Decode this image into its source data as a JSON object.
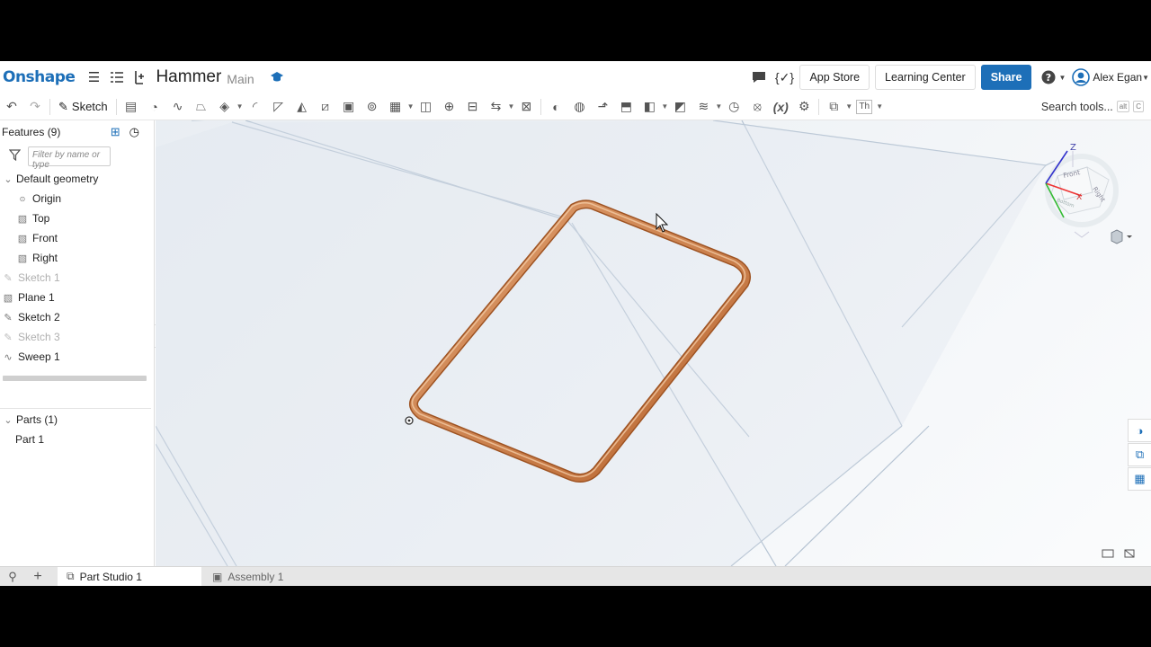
{
  "app": {
    "logo": "Onshape",
    "doc_title": "Hammer",
    "branch": "Main",
    "buttons": {
      "app_store": "App Store",
      "learning_center": "Learning Center",
      "share": "Share"
    },
    "user": "Alex Egan"
  },
  "toolbar": {
    "sketch": "Sketch",
    "search": "Search tools...",
    "shortcut_1": "alt",
    "shortcut_2": "C",
    "variable": "(x)",
    "text_tool": "Th"
  },
  "features": {
    "header": "Features (9)",
    "filter_placeholder": "Filter by name or type",
    "default_geometry": "Default geometry",
    "items": [
      {
        "label": "Origin",
        "dim": false
      },
      {
        "label": "Top",
        "dim": false
      },
      {
        "label": "Front",
        "dim": false
      },
      {
        "label": "Right",
        "dim": false
      },
      {
        "label": "Sketch 1",
        "dim": true
      },
      {
        "label": "Plane 1",
        "dim": false
      },
      {
        "label": "Sketch 2",
        "dim": false
      },
      {
        "label": "Sketch 3",
        "dim": true
      },
      {
        "label": "Sweep 1",
        "dim": false
      }
    ],
    "parts_header": "Parts (1)",
    "parts": [
      "Part 1"
    ]
  },
  "view_cube": {
    "axis_z": "Z",
    "axis_x": "X",
    "face_front": "Front",
    "face_right": "Right",
    "face_bottom": "Bottom"
  },
  "tabs": [
    {
      "label": "Part Studio 1",
      "active": true
    },
    {
      "label": "Assembly 1",
      "active": false
    }
  ],
  "colors": {
    "brand": "#1d6fb8",
    "copper": "#c8743e"
  }
}
